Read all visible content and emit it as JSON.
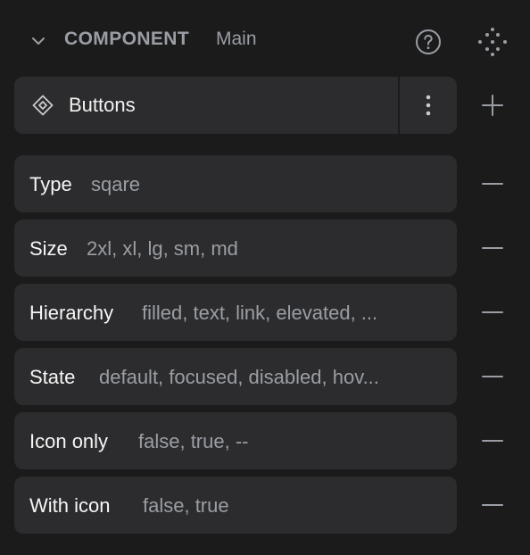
{
  "header": {
    "section_label": "COMPONENT",
    "section_value": "Main",
    "help_icon": "question-circle-icon",
    "component_grid_icon": "component-dots-icon",
    "collapse_icon": "chevron-down-icon"
  },
  "component": {
    "name": "Buttons",
    "icon": "component-diamond-icon",
    "more_icon": "more-vertical-icon",
    "add_icon": "plus-icon"
  },
  "properties": [
    {
      "name": "Type",
      "values": "sqare"
    },
    {
      "name": "Size",
      "values": "2xl, xl, lg, sm, md"
    },
    {
      "name": "Hierarchy",
      "values": "filled, text, link, elevated, ..."
    },
    {
      "name": "State",
      "values": "default, focused, disabled, hov..."
    },
    {
      "name": "Icon only",
      "values": "false, true, --"
    },
    {
      "name": "With icon",
      "values": "false, true"
    }
  ],
  "colors": {
    "background": "#1b1b1c",
    "card": "#2c2c2e",
    "muted_text": "#9a9ea4",
    "primary_text": "#f2f2f2"
  }
}
